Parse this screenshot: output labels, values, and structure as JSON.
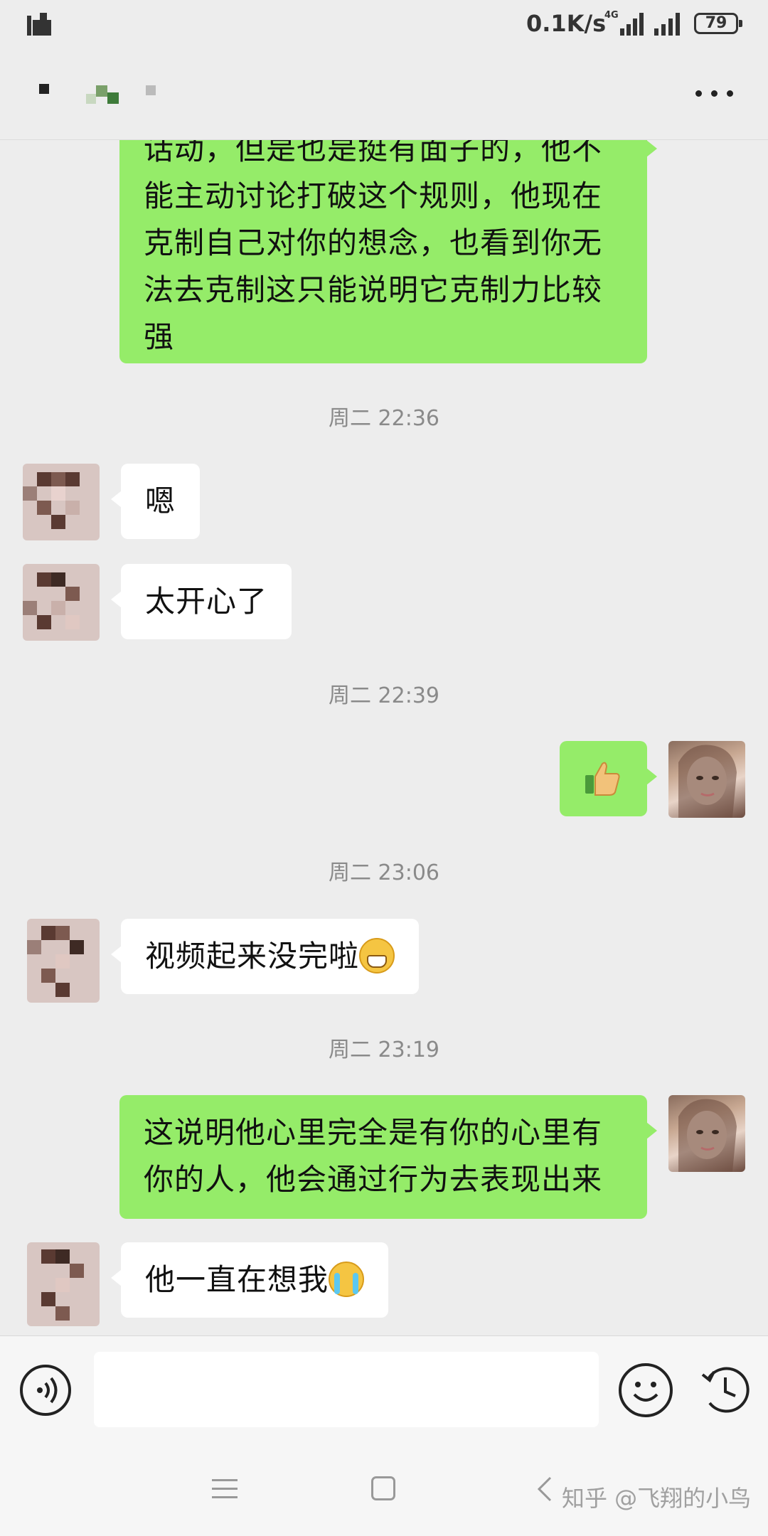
{
  "status_bar": {
    "net_speed": "0.1K/s",
    "network_type": "4G",
    "battery_level": "79"
  },
  "header": {
    "more_icon": "more-dots-icon"
  },
  "messages": [
    {
      "type": "out",
      "text_lines": [
        "话动，但是也是挺有面子的，他不",
        "能主动讨论打破这个规则，他现在",
        "克制自己对你的想念，也看到你无",
        "法去克制这只能说明它克制力比较",
        "强"
      ]
    },
    {
      "type": "time",
      "text": "周二 22:36"
    },
    {
      "type": "in",
      "text": "嗯"
    },
    {
      "type": "in",
      "text": "太开心了"
    },
    {
      "type": "time",
      "text": "周二 22:39"
    },
    {
      "type": "out",
      "emoji": "thumbs-up"
    },
    {
      "type": "time",
      "text": "周二 23:06"
    },
    {
      "type": "in",
      "text": "视频起来没完啦",
      "emoji": "grin"
    },
    {
      "type": "time",
      "text": "周二 23:19"
    },
    {
      "type": "out",
      "text_lines": [
        "这说明他心里完全是有你的心里有",
        "你的人，他会通过行为去表现出来"
      ]
    },
    {
      "type": "in",
      "text": "他一直在想我",
      "emoji": "cry"
    }
  ],
  "input_bar": {
    "voice_icon": "voice-icon",
    "emoji_icon": "emoji-icon",
    "extra_icon": "history-icon"
  },
  "watermark": "知乎 @飞翔的小鸟",
  "colors": {
    "outgoing": "#95ec69",
    "incoming": "#ffffff",
    "background": "#ededed"
  }
}
